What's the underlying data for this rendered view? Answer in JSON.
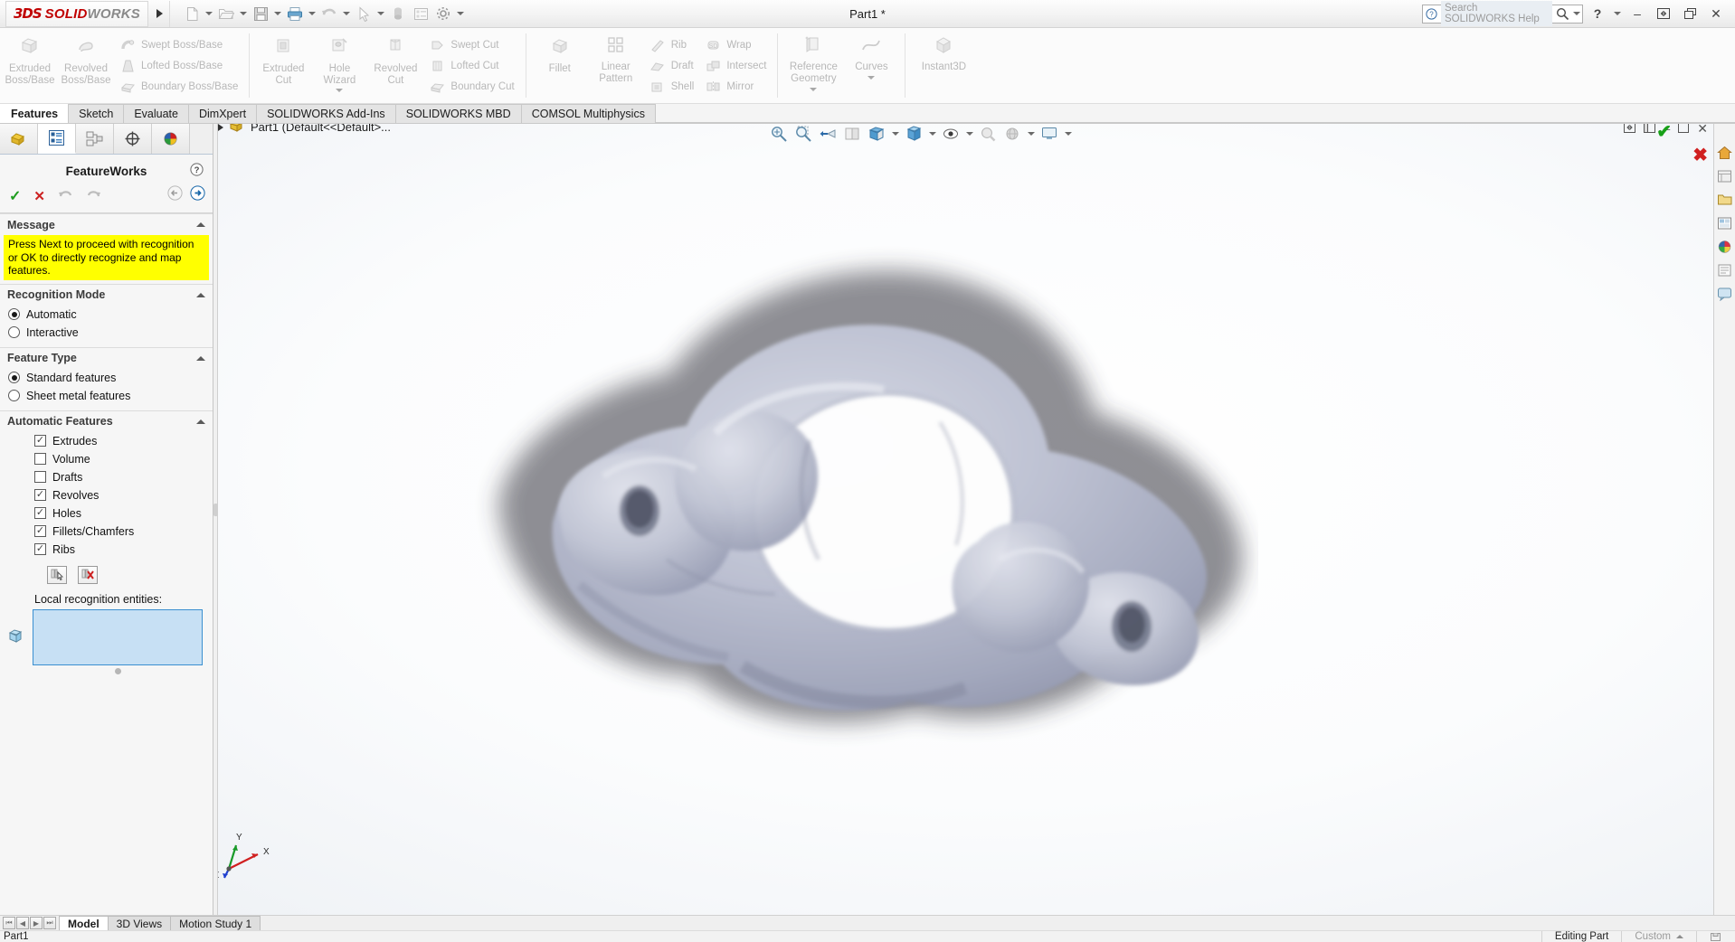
{
  "app": {
    "brand_ds": "3DS",
    "brand_solid": "SOLID",
    "brand_works": "WORKS",
    "title": "Part1 *"
  },
  "search": {
    "placeholder": "Search SOLIDWORKS Help",
    "icon": "search-icon"
  },
  "window_controls": {
    "help": "?",
    "minimize": "–",
    "restore": "❐",
    "close": "✕"
  },
  "quick_access": [
    {
      "name": "new-document",
      "glyph": "□"
    },
    {
      "name": "open-document",
      "glyph": "▱"
    },
    {
      "name": "save-document",
      "glyph": "▤"
    },
    {
      "name": "print-document",
      "glyph": "⎙"
    },
    {
      "name": "undo",
      "glyph": "↶"
    },
    {
      "name": "select",
      "glyph": "➤"
    },
    {
      "name": "rebuild",
      "glyph": "●"
    },
    {
      "name": "file-properties",
      "glyph": "☰"
    },
    {
      "name": "options",
      "glyph": "⚙"
    }
  ],
  "ribbon": {
    "groups": [
      {
        "name": "boss-base",
        "big": [
          {
            "label": "Extruded\nBoss/Base",
            "icon": "extruded-boss-icon"
          },
          {
            "label": "Revolved\nBoss/Base",
            "icon": "revolved-boss-icon"
          }
        ],
        "small": [
          {
            "label": "Swept Boss/Base",
            "icon": "swept-boss-icon"
          },
          {
            "label": "Lofted Boss/Base",
            "icon": "lofted-boss-icon"
          },
          {
            "label": "Boundary Boss/Base",
            "icon": "boundary-boss-icon"
          }
        ]
      },
      {
        "name": "cut",
        "big": [
          {
            "label": "Extruded\nCut",
            "icon": "extruded-cut-icon"
          },
          {
            "label": "Hole\nWizard",
            "icon": "hole-wizard-icon",
            "has_dropdown": true
          },
          {
            "label": "Revolved\nCut",
            "icon": "revolved-cut-icon"
          }
        ],
        "small": [
          {
            "label": "Swept Cut",
            "icon": "swept-cut-icon"
          },
          {
            "label": "Lofted Cut",
            "icon": "lofted-cut-icon"
          },
          {
            "label": "Boundary Cut",
            "icon": "boundary-cut-icon"
          }
        ]
      },
      {
        "name": "features",
        "big": [
          {
            "label": "Fillet",
            "icon": "fillet-icon"
          },
          {
            "label": "Linear\nPattern",
            "icon": "linear-pattern-icon"
          }
        ],
        "small": [
          {
            "label": "Rib",
            "icon": "rib-icon"
          },
          {
            "label": "Draft",
            "icon": "draft-icon"
          },
          {
            "label": "Shell",
            "icon": "shell-icon"
          }
        ],
        "small2": [
          {
            "label": "Wrap",
            "icon": "wrap-icon"
          },
          {
            "label": "Intersect",
            "icon": "intersect-icon"
          },
          {
            "label": "Mirror",
            "icon": "mirror-icon"
          }
        ]
      },
      {
        "name": "reference",
        "big": [
          {
            "label": "Reference\nGeometry",
            "icon": "reference-geometry-icon",
            "has_dropdown": true
          },
          {
            "label": "Curves",
            "icon": "curves-icon",
            "has_dropdown": true
          }
        ]
      },
      {
        "name": "instant3d",
        "big": [
          {
            "label": "Instant3D",
            "icon": "instant3d-icon"
          }
        ]
      }
    ]
  },
  "tabs": [
    {
      "label": "Features",
      "active": true
    },
    {
      "label": "Sketch",
      "active": false
    },
    {
      "label": "Evaluate",
      "active": false
    },
    {
      "label": "DimXpert",
      "active": false
    },
    {
      "label": "SOLIDWORKS Add-Ins",
      "active": false
    },
    {
      "label": "SOLIDWORKS MBD",
      "active": false
    },
    {
      "label": "COMSOL Multiphysics",
      "active": false
    }
  ],
  "property_manager": {
    "tabs": [
      {
        "name": "feature-manager-tree-tab",
        "icon": "feature-tree-icon",
        "active": false
      },
      {
        "name": "property-manager-tab",
        "icon": "property-manager-icon",
        "active": true
      },
      {
        "name": "configuration-manager-tab",
        "icon": "configuration-icon",
        "active": false
      },
      {
        "name": "dimxpert-manager-tab",
        "icon": "dimxpert-icon",
        "active": false
      },
      {
        "name": "display-manager-tab",
        "icon": "display-manager-icon",
        "active": false
      }
    ],
    "title": "FeatureWorks",
    "help_glyph": "?",
    "actions": {
      "ok": "✓",
      "cancel": "✕",
      "undo": "↶",
      "redo": "↷",
      "back": "←",
      "next": "→"
    },
    "sections": {
      "message": {
        "header": "Message",
        "text": "Press Next to proceed with recognition or OK to directly recognize and map features."
      },
      "recognition_mode": {
        "header": "Recognition Mode",
        "options": [
          {
            "label": "Automatic",
            "selected": true
          },
          {
            "label": "Interactive",
            "selected": false
          }
        ]
      },
      "feature_type": {
        "header": "Feature Type",
        "options": [
          {
            "label": "Standard features",
            "selected": true
          },
          {
            "label": "Sheet metal features",
            "selected": false
          }
        ]
      },
      "automatic_features": {
        "header": "Automatic Features",
        "items": [
          {
            "label": "Extrudes",
            "checked": true
          },
          {
            "label": "Volume",
            "checked": false
          },
          {
            "label": "Drafts",
            "checked": false
          },
          {
            "label": "Revolves",
            "checked": true
          },
          {
            "label": "Holes",
            "checked": true
          },
          {
            "label": "Fillets/Chamfers",
            "checked": true
          },
          {
            "label": "Ribs",
            "checked": true
          }
        ],
        "tool_buttons": [
          {
            "name": "select-entities-button",
            "icon": "cursor-select-icon"
          },
          {
            "name": "clear-entities-button",
            "icon": "cursor-clear-icon"
          }
        ],
        "local_label": "Local recognition entities:",
        "local_entities_value": ""
      }
    }
  },
  "feature_tree": {
    "root_label": "Part1  (Default<<Default>...",
    "icon": "part-icon"
  },
  "viewport": {
    "toolbar": [
      {
        "name": "zoom-to-fit-button",
        "icon": "zoom-fit-icon"
      },
      {
        "name": "zoom-to-area-button",
        "icon": "zoom-area-icon"
      },
      {
        "name": "previous-view-button",
        "icon": "previous-view-icon"
      },
      {
        "name": "section-view-button",
        "icon": "section-view-icon"
      },
      {
        "name": "view-orientation-button",
        "icon": "view-orientation-icon"
      },
      {
        "name": "display-style-button",
        "icon": "display-style-icon",
        "has_dropdown": true
      },
      {
        "name": "hide-show-items-button",
        "icon": "hide-show-icon",
        "has_dropdown": true
      },
      {
        "name": "edit-appearance-button",
        "icon": "appearance-icon",
        "has_dropdown": true
      },
      {
        "name": "apply-scene-button",
        "icon": "scene-icon",
        "has_dropdown": true
      },
      {
        "name": "view-settings-button",
        "icon": "display-monitor-icon",
        "has_dropdown": true
      }
    ],
    "window_buttons": [
      {
        "name": "restore-viewport-button",
        "glyph": "❐"
      },
      {
        "name": "dock-viewport-button",
        "glyph": "⧉"
      },
      {
        "name": "minimize-viewport-button",
        "glyph": "–"
      },
      {
        "name": "maximize-viewport-button",
        "glyph": "❑"
      },
      {
        "name": "close-viewport-button",
        "glyph": "✕"
      }
    ],
    "confirm_ok": "✔",
    "confirm_cancel": "✖",
    "triad_axes": [
      "X",
      "Y",
      "Z"
    ],
    "model_name": "vertebra-mesh-model"
  },
  "task_pane": [
    {
      "name": "sw-resources-icon",
      "glyph": "⌂"
    },
    {
      "name": "design-library-icon",
      "glyph": "☰"
    },
    {
      "name": "file-explorer-icon",
      "glyph": "▤"
    },
    {
      "name": "view-palette-icon",
      "glyph": "▣"
    },
    {
      "name": "appearances-scenes-icon",
      "glyph": "◕"
    },
    {
      "name": "custom-properties-icon",
      "glyph": "≡"
    },
    {
      "name": "solidworks-forum-icon",
      "glyph": "▦"
    }
  ],
  "bottom": {
    "nav_buttons": [
      "⏮",
      "◀",
      "▶",
      "⏭"
    ],
    "tabs": [
      {
        "label": "Model",
        "active": true
      },
      {
        "label": "3D Views",
        "active": false
      },
      {
        "label": "Motion Study 1",
        "active": false
      }
    ]
  },
  "status_bar": {
    "left": "Part1",
    "editing": "Editing Part",
    "custom": "Custom",
    "save_icon": "save-status-icon"
  }
}
